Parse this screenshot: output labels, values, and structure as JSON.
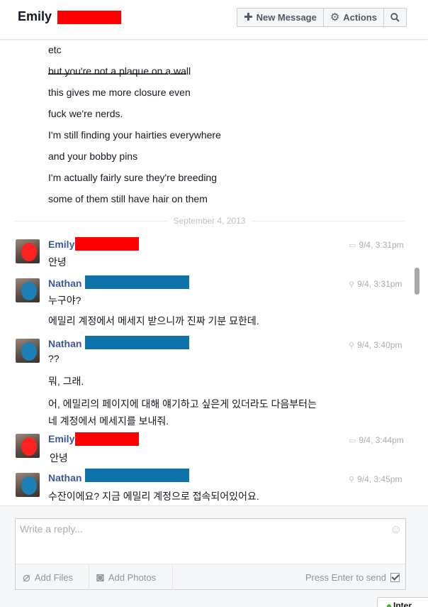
{
  "header": {
    "thread_title": "Emily",
    "new_message_label": "New Message",
    "actions_label": "Actions"
  },
  "history": {
    "lines": [
      "etc",
      "but you're not a plaque on a wall",
      "this gives me more closure even",
      "fuck we're nerds.",
      "I'm still finding your hairties everywhere",
      "and your bobby pins",
      "I'm actually fairly sure they're breeding",
      "some of them still have hair on them"
    ]
  },
  "date_separator": "September 4, 2013",
  "messages": [
    {
      "sender": "Emily",
      "time": "9/4, 3:31pm",
      "lines": [
        "안녕"
      ]
    },
    {
      "sender": "Nathan",
      "time": "9/4, 3:31pm",
      "lines": [
        "누구야?",
        "에밀리 계정에서 메세지 받으니까 진짜 기분 묘한데."
      ]
    },
    {
      "sender": "Nathan",
      "time": "9/4, 3:40pm",
      "lines": [
        "??",
        "뭐, 그래.",
        "어, 에밀리의 페이지에 대해 얘기하고 싶은게 있더라도 다음부터는",
        "네 계정에서 메세지를 보내줘."
      ]
    },
    {
      "sender": "Emily",
      "time": "9/4, 3:44pm",
      "lines": [
        "안녕"
      ]
    },
    {
      "sender": "Nathan",
      "time": "9/4, 3:45pm",
      "lines": [
        "수잔이에요? 지금 에밀리 계정으로 접속되어있어요."
      ]
    }
  ],
  "composer": {
    "placeholder": "Write a reply...",
    "add_files_label": "Add Files",
    "add_photos_label": "Add Photos",
    "press_enter_label": "Press Enter to send",
    "press_enter_checked": true
  },
  "chat_tab": {
    "label": "Inter"
  },
  "colors": {
    "redaction_red": "#ff0000",
    "redaction_blue": "#0e73a8",
    "sender_link": "#3b5998"
  }
}
